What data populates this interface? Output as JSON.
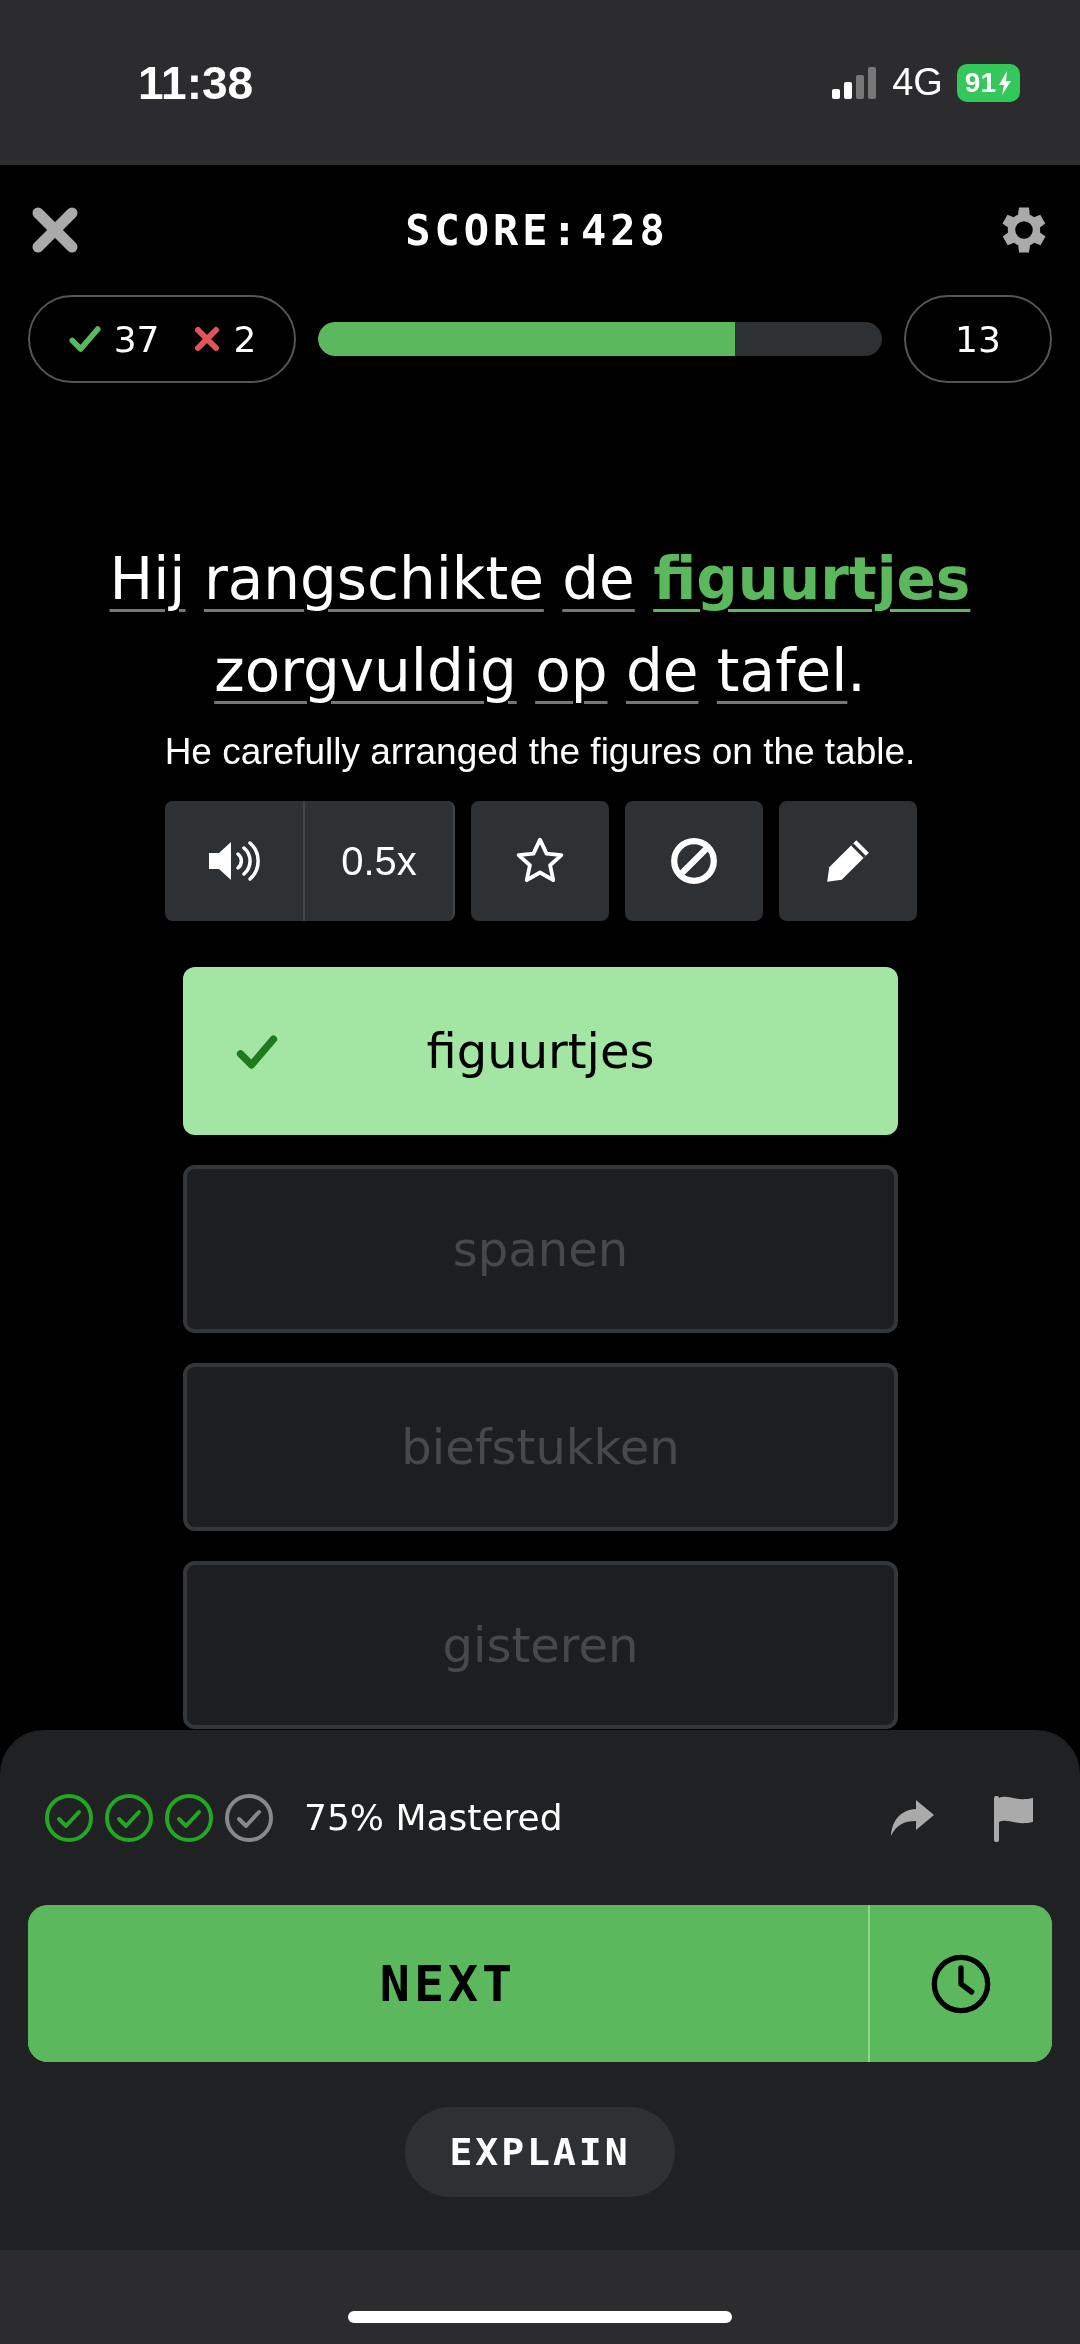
{
  "status_bar": {
    "time": "11:38",
    "network": "4G",
    "battery": "91"
  },
  "header": {
    "score": "SCORE:428"
  },
  "stats": {
    "correct": "37",
    "wrong": "2",
    "progress": {
      "level": 0.74
    },
    "remaining": "13"
  },
  "sentence": {
    "words": [
      {
        "text": "Hij",
        "kind": "word"
      },
      {
        "text": "rangschikte",
        "kind": "word"
      },
      {
        "text": "de",
        "kind": "word"
      },
      {
        "text": "figuurtjes",
        "kind": "answer"
      },
      {
        "text": "zorgvuldig",
        "kind": "word"
      },
      {
        "text": "op",
        "kind": "word"
      },
      {
        "text": "de",
        "kind": "word"
      },
      {
        "text": "tafel",
        "kind": "word"
      },
      {
        "text": ".",
        "kind": "punct"
      }
    ],
    "translation": "He carefully arranged the figures on the table."
  },
  "tools": {
    "speed": "0.5x"
  },
  "options": [
    {
      "text": "figuurtjes",
      "kind": "correct"
    },
    {
      "text": "spanen",
      "kind": "disabled"
    },
    {
      "text": "biefstukken",
      "kind": "disabled"
    },
    {
      "text": "gisteren",
      "kind": "disabled"
    }
  ],
  "mastery": {
    "steps": [
      {
        "checked": true
      },
      {
        "checked": true
      },
      {
        "checked": true
      },
      {
        "checked": false
      }
    ],
    "label": "75% Mastered"
  },
  "buttons": {
    "next": "NEXT",
    "explain": "EXPLAIN"
  }
}
